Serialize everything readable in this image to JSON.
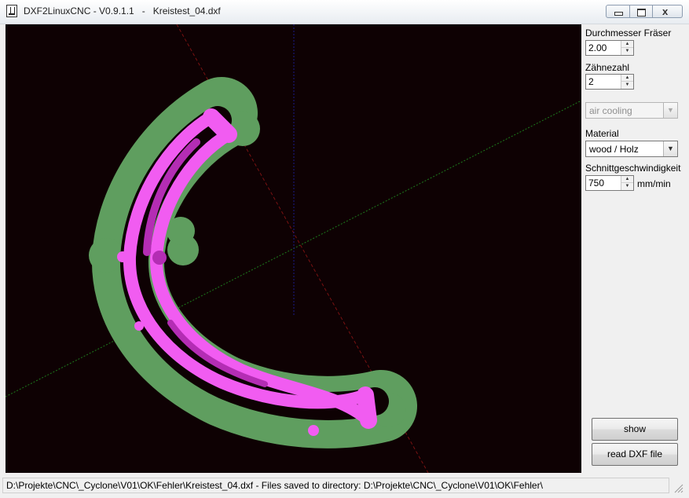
{
  "window": {
    "title": "DXF2LinuxCNC - V0.9.1.1   -   Kreistest_04.dxf",
    "minimize_glyph": "_",
    "maximize_glyph": "□",
    "close_glyph": "x"
  },
  "viewport": {
    "background_color": "#0e0103",
    "colors": {
      "outer_offset": "#5f9e5f",
      "inner_path": "#f15cf1",
      "path_shade": "#b42db4",
      "axis_x": "#1d7a1d",
      "axis_y": "#7a1212",
      "axis_z": "#1a1a8a"
    }
  },
  "panel": {
    "cutter_diameter": {
      "label": "Durchmesser Fräser",
      "value": "2.00"
    },
    "teeth_count": {
      "label": "Zähnezahl",
      "value": "2"
    },
    "cooling": {
      "selected": "air cooling",
      "enabled": false
    },
    "material": {
      "label": "Material",
      "selected": "wood / Holz"
    },
    "cutting_speed": {
      "label": "Schnittgeschwindigkeit",
      "value": "750",
      "unit": "mm/min"
    },
    "show_button": "show",
    "read_dxf_button": "read DXF file"
  },
  "status": {
    "text": "D:\\Projekte\\CNC\\_Cyclone\\V01\\OK\\Fehler\\Kreistest_04.dxf  -  Files saved to directory: D:\\Projekte\\CNC\\_Cyclone\\V01\\OK\\Fehler\\"
  }
}
